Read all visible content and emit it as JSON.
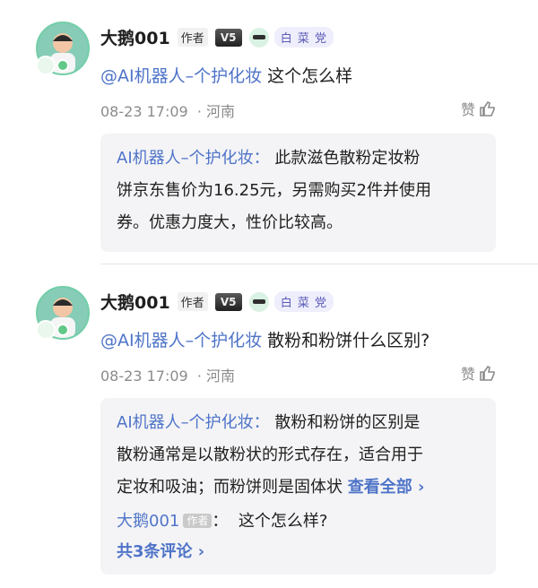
{
  "comments": [
    {
      "user": "大鹅001",
      "author_tag": "作者",
      "level": "V5",
      "badge": "白 菜 党",
      "mention": "@AI机器人–个护化妆",
      "text": " 这个怎么样",
      "time": "08-23 17:09",
      "location": "· 河南",
      "like": "赞",
      "reply_author": "AI机器人–个护化妆：",
      "reply_lines": [
        "此款滋色散粉定妆粉",
        "饼京东售价为16.25元，另需购买2件并使用",
        "券。优惠力度大，性价比较高。"
      ]
    },
    {
      "user": "大鹅001",
      "author_tag": "作者",
      "level": "V5",
      "badge": "白 菜 党",
      "mention": "@AI机器人–个护化妆",
      "text": " 散粉和粉饼什么区别?",
      "time": "08-23 17:09",
      "location": "· 河南",
      "like": "赞",
      "reply_author": "AI机器人–个护化妆：",
      "reply_lines": [
        "散粉和粉饼的区别是",
        "散粉通常是以散粉状的形式存在，适合用于",
        "定妆和吸油；而粉饼则是固体状"
      ],
      "view_all": "查看全部 ›",
      "sub_user": "大鹅001",
      "sub_tag": "作者",
      "sub_text": "这个怎么样?",
      "more_replies": "共3条评论 ›"
    }
  ]
}
